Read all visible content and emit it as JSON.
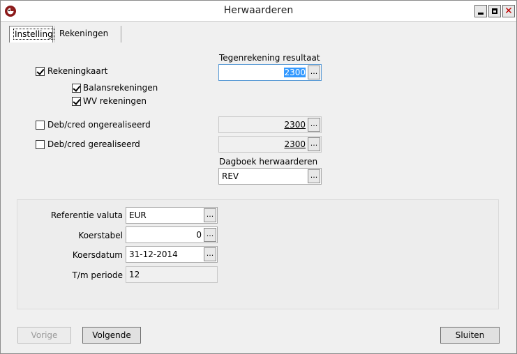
{
  "window": {
    "title": "Herwaarderen"
  },
  "tabs": [
    {
      "label": "Instelling",
      "active": true
    },
    {
      "label": "Rekeningen",
      "active": false
    }
  ],
  "settings": {
    "tegenrekening_label": "Tegenrekening resultaat",
    "tegenrekening_value": "2300",
    "rekeningkaart": {
      "label": "Rekeningkaart",
      "checked": true
    },
    "balansrekeningen": {
      "label": "Balansrekeningen",
      "checked": true
    },
    "wv_rekeningen": {
      "label": "WV rekeningen",
      "checked": true
    },
    "debcred_ongerealiseerd": {
      "label": "Deb/cred ongerealiseerd",
      "checked": false,
      "value": "2300"
    },
    "debcred_gerealiseerd": {
      "label": "Deb/cred gerealiseerd",
      "checked": false,
      "value": "2300"
    },
    "dagboek_label": "Dagboek herwaarderen",
    "dagboek_value": "REV",
    "ellipsis": "..."
  },
  "currency": {
    "referentie_label": "Referentie valuta",
    "referentie_value": "EUR",
    "koerstabel_label": "Koerstabel",
    "koerstabel_value": "0",
    "koersdatum_label": "Koersdatum",
    "koersdatum_value": "31-12-2014",
    "periode_label": "T/m periode",
    "periode_value": "12"
  },
  "buttons": {
    "vorige": "Vorige",
    "volgende": "Volgende",
    "sluiten": "Sluiten"
  },
  "colors": {
    "accent_selection": "#3399ff",
    "close_icon": "#c00000"
  }
}
